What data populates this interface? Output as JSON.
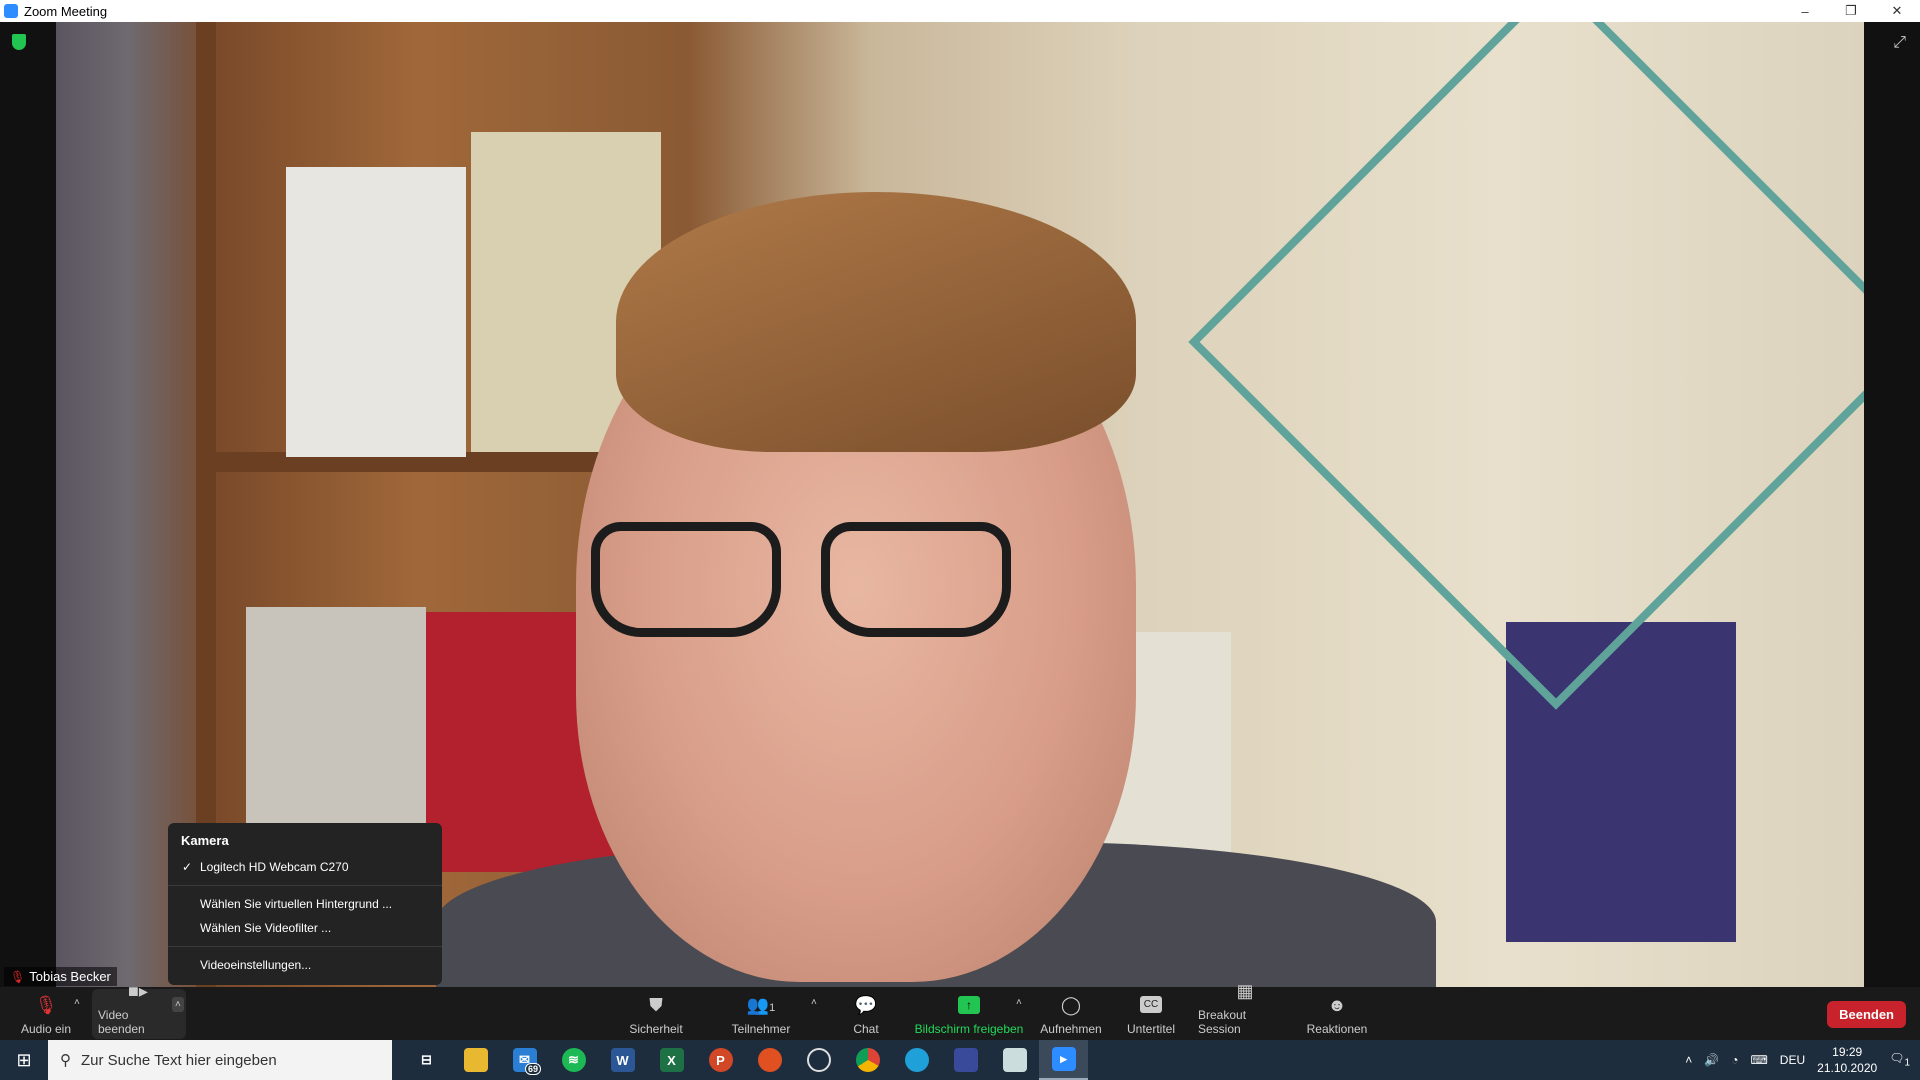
{
  "window": {
    "title": "Zoom Meeting",
    "minimize": "–",
    "restore": "❐",
    "close": "✕"
  },
  "participant": {
    "name": "Tobias Becker"
  },
  "camera_menu": {
    "header": "Kamera",
    "items": [
      {
        "label": "Logitech HD Webcam C270",
        "checked": true
      },
      {
        "label": "Wählen Sie virtuellen Hintergrund ..."
      },
      {
        "label": "Wählen Sie Videofilter ..."
      },
      {
        "label": "Videoeinstellungen..."
      }
    ],
    "check": "✓"
  },
  "toolbar": {
    "audio": "Audio ein",
    "video": "Video beenden",
    "security": "Sicherheit",
    "participants": "Teilnehmer",
    "participants_count": "1",
    "chat": "Chat",
    "share": "Bildschirm freigeben",
    "record": "Aufnehmen",
    "captions": "Untertitel",
    "breakout": "Breakout Session",
    "reactions": "Reaktionen",
    "end": "Beenden",
    "caret": "˄",
    "cc": "CC"
  },
  "colors": {
    "share_green": "#23d959",
    "end_red": "#c8232c",
    "zoom_blue": "#2d8cff"
  },
  "taskbar": {
    "search_placeholder": "Zur Suche Text hier eingeben",
    "mail_badge": "69",
    "apps": [
      "task-view",
      "file-explorer",
      "mail",
      "spotify",
      "word",
      "excel",
      "powerpoint",
      "app",
      "obs",
      "chrome",
      "edge",
      "app",
      "notepad",
      "zoom"
    ],
    "language": "DEU",
    "time": "19:29",
    "date": "21.10.2020",
    "notifications": "1"
  }
}
